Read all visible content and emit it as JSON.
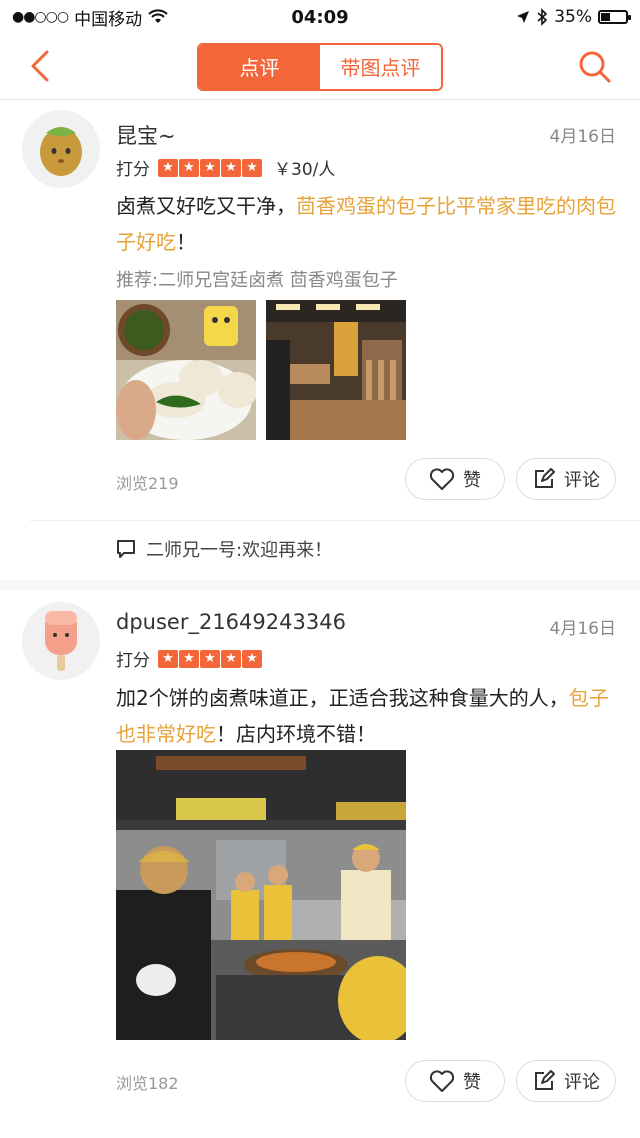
{
  "status_bar": {
    "signal_dots": "●●○○○",
    "carrier": "中国移动",
    "time": "04:09",
    "battery": "35%"
  },
  "nav": {
    "tabs": [
      {
        "label": "点评",
        "active": true
      },
      {
        "label": "带图点评",
        "active": false
      }
    ],
    "accent": "#f2663a"
  },
  "reviews": [
    {
      "user": "昆宝~",
      "date": "4月16日",
      "rating_label": "打分",
      "stars": 5,
      "price": "￥30/人",
      "content_plain": "卤煮又好吃又干净，",
      "content_highlight": "茴香鸡蛋的包子比平常家里吃的肉包子好吃",
      "content_end": "！",
      "recommend": "推荐:二师兄宫廷卤煮 茴香鸡蛋包子",
      "views": "浏览219",
      "like_label": "赞",
      "comment_label": "评论",
      "reply": "二师兄一号:欢迎再来！"
    },
    {
      "user": "dpuser_21649243346",
      "date": "4月16日",
      "rating_label": "打分",
      "stars": 5,
      "content_plain": "加2个饼的卤煮味道正，正适合我这种食量大的人，",
      "content_highlight": "包子也非常好吃",
      "content_end": "！店内环境不错！",
      "views": "浏览182",
      "like_label": "赞",
      "comment_label": "评论"
    }
  ],
  "highlight_color": "#e8a23a"
}
